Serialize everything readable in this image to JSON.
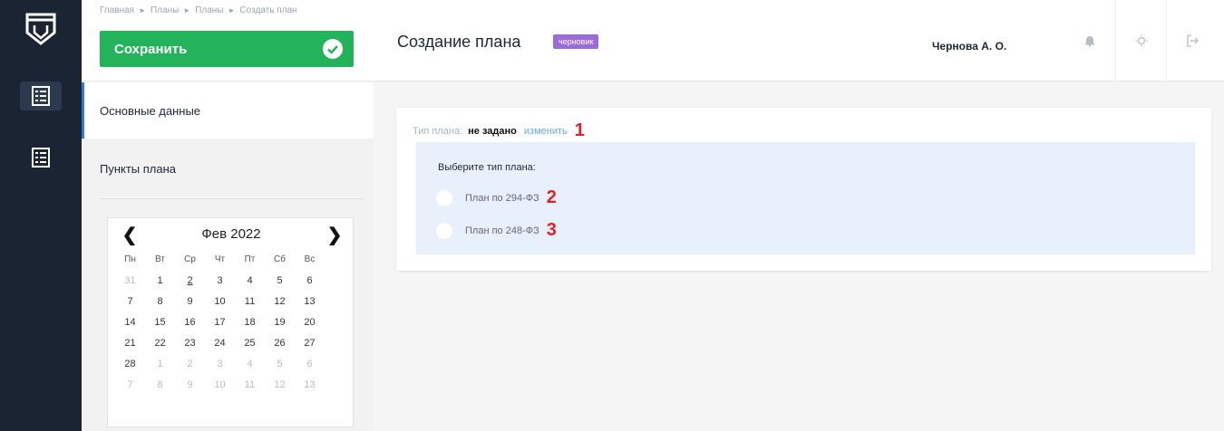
{
  "breadcrumb": [
    "Главная",
    "Планы",
    "Планы",
    "Создать план"
  ],
  "toolbar": {
    "save_label": "Сохранить"
  },
  "page": {
    "title": "Создание плана",
    "status_badge": "черновик"
  },
  "user": {
    "name": "Чернова А. О."
  },
  "nav": {
    "items": [
      "Основные данные",
      "Пункты плана"
    ]
  },
  "calendar": {
    "month_title": "Фев 2022",
    "weekdays": [
      "Пн",
      "Вт",
      "Ср",
      "Чт",
      "Пт",
      "Сб",
      "Вс"
    ],
    "weeks": [
      [
        "31",
        "1",
        "2",
        "3",
        "4",
        "5",
        "6"
      ],
      [
        "7",
        "8",
        "9",
        "10",
        "11",
        "12",
        "13"
      ],
      [
        "14",
        "15",
        "16",
        "17",
        "18",
        "19",
        "20"
      ],
      [
        "21",
        "22",
        "23",
        "24",
        "25",
        "26",
        "27"
      ],
      [
        "28",
        "1",
        "2",
        "3",
        "4",
        "5",
        "6"
      ],
      [
        "7",
        "8",
        "9",
        "10",
        "11",
        "12",
        "13"
      ]
    ]
  },
  "plan_type": {
    "label": "Тип плана:",
    "value": "не задано",
    "change_link": "изменить",
    "marker": "1",
    "select_title": "Выберите тип плана:",
    "options": [
      {
        "label": "План по 294-ФЗ",
        "marker": "2"
      },
      {
        "label": "План по 248-ФЗ",
        "marker": "3"
      }
    ]
  },
  "colors": {
    "save_green": "#23b35b",
    "badge_purple": "#9b6bd8",
    "rail_dark": "#1b2433",
    "active_blue": "#2c7be5",
    "marker_red": "#e0202c"
  }
}
